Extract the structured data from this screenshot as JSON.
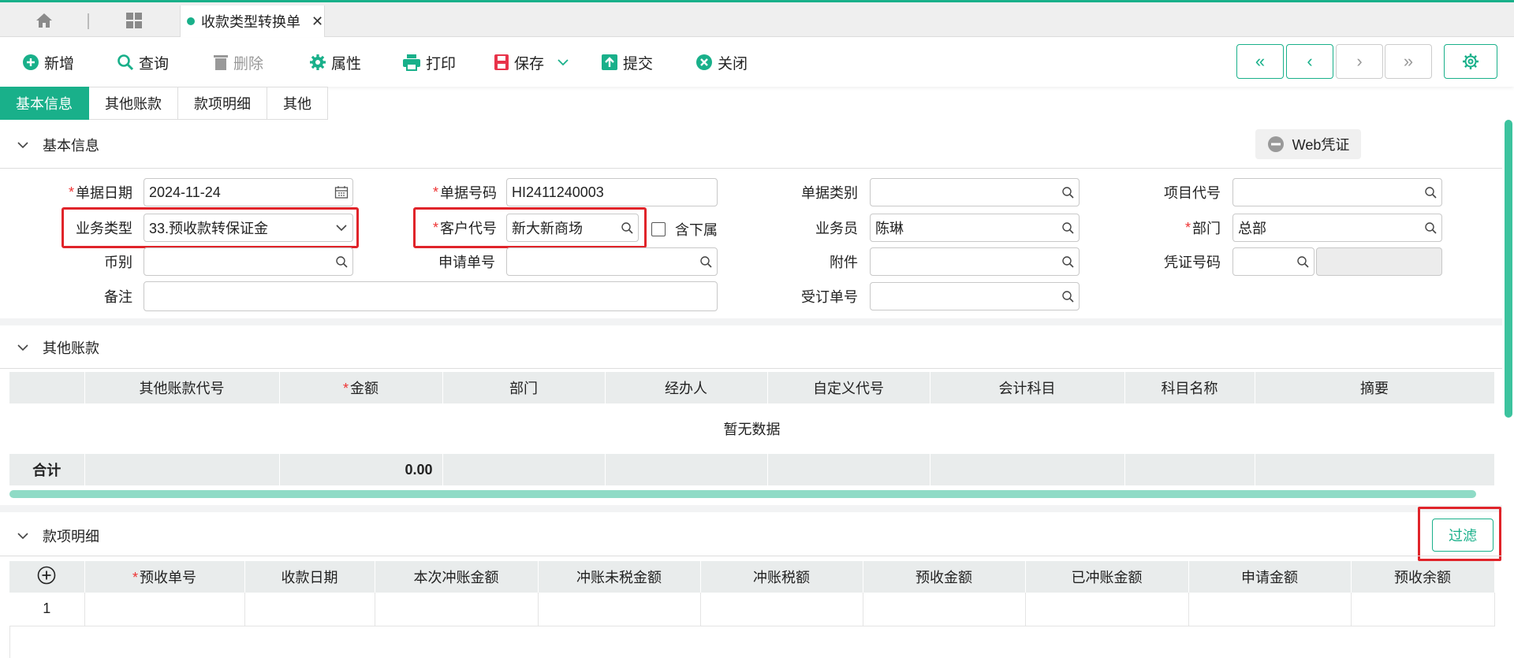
{
  "tab": {
    "title": "收款类型转换单",
    "close": "✕"
  },
  "toolbar": {
    "new": "新增",
    "query": "查询",
    "delete": "删除",
    "props": "属性",
    "print": "打印",
    "save": "保存",
    "submit": "提交",
    "close": "关闭"
  },
  "nav": {
    "first": "«",
    "prev": "‹",
    "next": "›",
    "last": "»"
  },
  "subtabs": [
    "基本信息",
    "其他账款",
    "款项明细",
    "其他"
  ],
  "basic": {
    "section_title": "基本信息",
    "web_voucher": "Web凭证",
    "fields": {
      "doc_date": {
        "label": "单据日期",
        "value": "2024-11-24"
      },
      "doc_no": {
        "label": "单据号码",
        "value": "HI2411240003"
      },
      "doc_type": {
        "label": "单据类别",
        "value": ""
      },
      "project_code": {
        "label": "项目代号",
        "value": ""
      },
      "biz_type": {
        "label": "业务类型",
        "value": "33.预收款转保证金"
      },
      "customer_code": {
        "label": "客户代号",
        "value": "新大新商场"
      },
      "include_sub": {
        "label": "含下属",
        "checked": false
      },
      "salesman": {
        "label": "业务员",
        "value": "陈琳"
      },
      "dept": {
        "label": "部门",
        "value": "总部"
      },
      "currency": {
        "label": "币别",
        "value": ""
      },
      "apply_no": {
        "label": "申请单号",
        "value": ""
      },
      "attachment": {
        "label": "附件",
        "value": ""
      },
      "voucher_no": {
        "label": "凭证号码",
        "value": ""
      },
      "remark": {
        "label": "备注",
        "value": ""
      },
      "order_no": {
        "label": "受订单号",
        "value": ""
      }
    }
  },
  "other": {
    "section_title": "其他账款",
    "columns": [
      "其他账款代号",
      "金额",
      "部门",
      "经办人",
      "自定义代号",
      "会计科目",
      "科目名称",
      "摘要"
    ],
    "empty_text": "暂无数据",
    "total_label": "合计",
    "total_amount": "0.00"
  },
  "detail": {
    "section_title": "款项明细",
    "filter": "过滤",
    "columns": [
      "预收单号",
      "收款日期",
      "本次冲账金额",
      "冲账未税金额",
      "冲账税额",
      "预收金额",
      "已冲账金额",
      "申请金额",
      "预收余额"
    ],
    "rows": [
      {
        "no": "1"
      }
    ]
  }
}
